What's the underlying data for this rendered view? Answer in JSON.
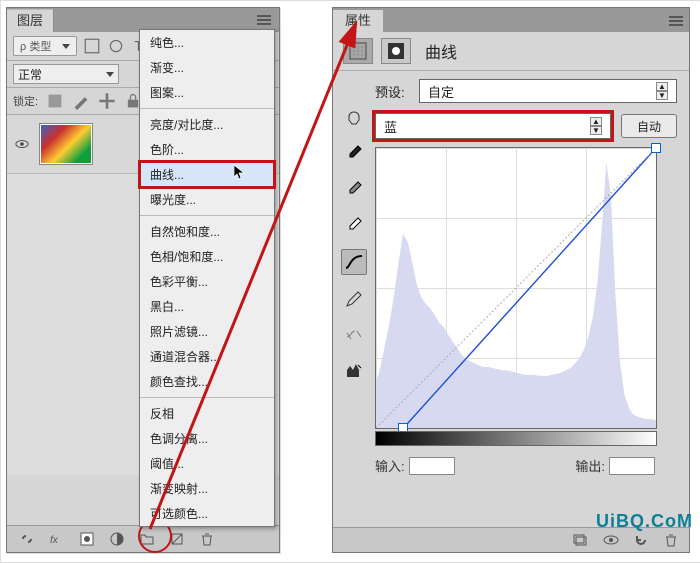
{
  "layers_panel": {
    "title": "图层",
    "type_filter_label": "类型",
    "blend_mode": "正常",
    "lock_label": "锁定:",
    "footer_icons": [
      "link",
      "fx",
      "mask",
      "adjust",
      "group",
      "new",
      "trash"
    ]
  },
  "adjustment_menu": {
    "groups": [
      [
        "纯色...",
        "渐变...",
        "图案..."
      ],
      [
        "亮度/对比度...",
        "色阶...",
        "曲线...",
        "曝光度..."
      ],
      [
        "自然饱和度...",
        "色相/饱和度...",
        "色彩平衡...",
        "黑白...",
        "照片滤镜...",
        "通道混合器...",
        "颜色查找..."
      ],
      [
        "反相",
        "色调分离...",
        "阈值...",
        "渐变映射...",
        "可选颜色..."
      ]
    ],
    "highlighted": "曲线..."
  },
  "properties_panel": {
    "title": "属性",
    "mode_label": "曲线",
    "preset_label": "预设:",
    "preset_value": "自定",
    "channel_value": "蓝",
    "auto_label": "自动",
    "input_label": "输入:",
    "output_label": "输出:"
  },
  "chart_data": {
    "type": "line",
    "title": "曲线",
    "xlabel": "输入",
    "ylabel": "输出",
    "xlim": [
      0,
      255
    ],
    "ylim": [
      0,
      255
    ],
    "series": [
      {
        "name": "蓝",
        "values_x": [
          25,
          255
        ],
        "values_y": [
          0,
          255
        ]
      }
    ],
    "control_points": [
      {
        "x": 25,
        "y": 0
      },
      {
        "x": 255,
        "y": 255
      }
    ],
    "histogram": [
      40,
      55,
      75,
      95,
      120,
      150,
      175,
      168,
      150,
      130,
      118,
      112,
      108,
      102,
      95,
      91,
      84,
      78,
      72,
      66,
      62,
      60,
      58,
      56,
      55,
      55,
      54,
      53,
      52,
      52,
      51,
      50,
      49,
      48,
      48,
      48,
      47,
      47,
      47,
      48,
      49,
      50,
      52,
      54,
      58,
      63,
      70,
      82,
      100,
      130,
      180,
      240,
      210,
      120,
      60,
      30,
      18,
      12,
      10,
      9,
      8,
      8,
      7
    ]
  },
  "watermark": "UiBQ.CoM"
}
